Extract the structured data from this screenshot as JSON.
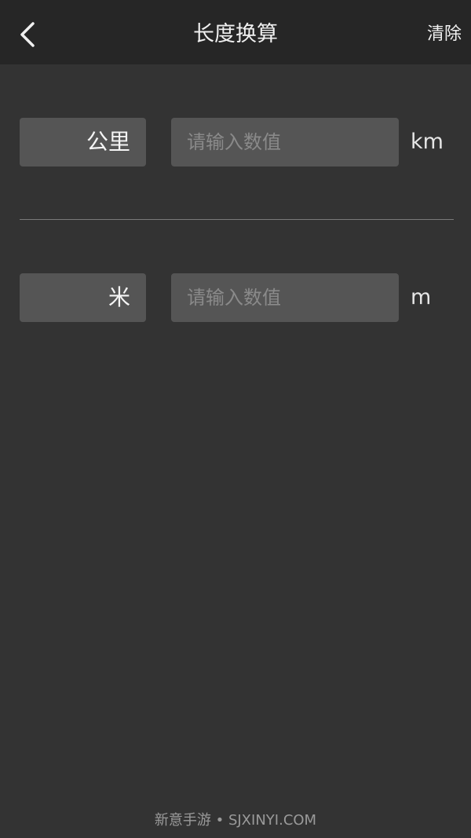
{
  "header": {
    "title": "长度换算",
    "clear_label": "清除",
    "back_icon": "chevron-left-icon"
  },
  "rows": [
    {
      "unit_name": "公里",
      "placeholder": "请输入数值",
      "value": "",
      "symbol": "km"
    },
    {
      "unit_name": "米",
      "placeholder": "请输入数值",
      "value": "",
      "symbol": "m"
    }
  ],
  "watermark": "新意手游 • SJXINYI.COM",
  "colors": {
    "background": "#333333",
    "topbar": "#262626",
    "field": "#555555",
    "placeholder": "#8a8a8a",
    "divider": "#7a7a7a"
  }
}
